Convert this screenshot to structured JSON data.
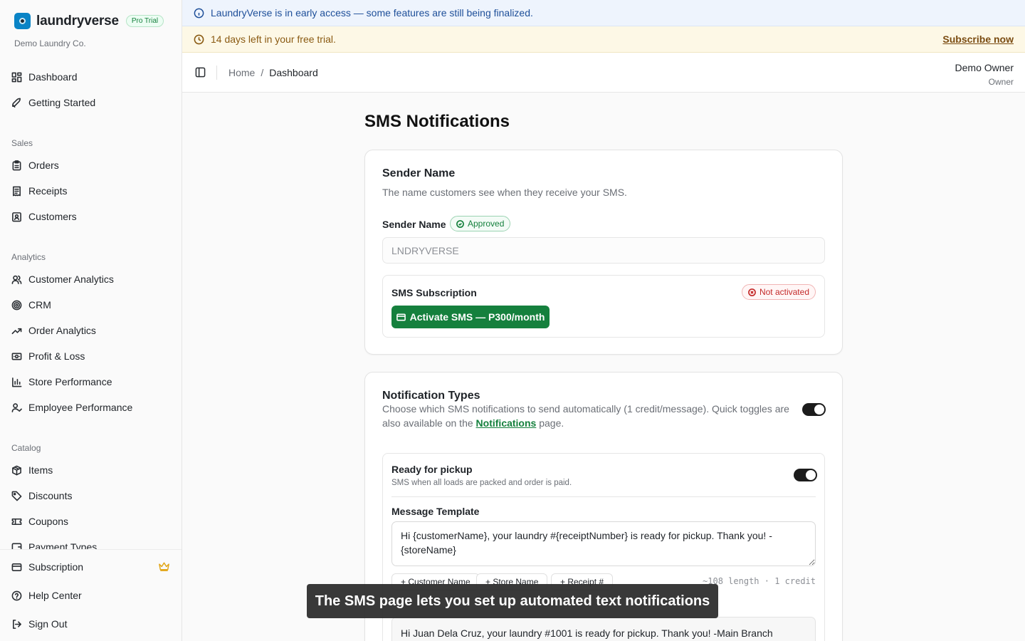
{
  "app": {
    "name": "laundryverse",
    "badge": "Pro Trial",
    "company": "Demo Laundry Co."
  },
  "sidebar": {
    "top_items": [
      {
        "label": "Dashboard",
        "icon": "grid-icon"
      },
      {
        "label": "Getting Started",
        "icon": "rocket-icon"
      }
    ],
    "sections": [
      {
        "title": "Sales",
        "items": [
          {
            "label": "Orders",
            "icon": "clipboard-icon"
          },
          {
            "label": "Receipts",
            "icon": "receipt-icon"
          },
          {
            "label": "Customers",
            "icon": "contact-icon"
          }
        ]
      },
      {
        "title": "Analytics",
        "items": [
          {
            "label": "Customer Analytics",
            "icon": "users-icon"
          },
          {
            "label": "CRM",
            "icon": "target-icon"
          },
          {
            "label": "Order Analytics",
            "icon": "trend-icon"
          },
          {
            "label": "Profit & Loss",
            "icon": "banknote-icon"
          },
          {
            "label": "Store Performance",
            "icon": "bar-chart-icon"
          },
          {
            "label": "Employee Performance",
            "icon": "user-check-icon"
          }
        ]
      },
      {
        "title": "Catalog",
        "items": [
          {
            "label": "Items",
            "icon": "package-icon"
          },
          {
            "label": "Discounts",
            "icon": "tag-icon"
          },
          {
            "label": "Coupons",
            "icon": "ticket-icon"
          },
          {
            "label": "Payment Types",
            "icon": "wallet-icon"
          }
        ]
      }
    ],
    "bottom_items": [
      {
        "label": "Subscription",
        "icon": "credit-card-icon"
      },
      {
        "label": "Help Center",
        "icon": "help-icon"
      },
      {
        "label": "Sign Out",
        "icon": "logout-icon"
      }
    ]
  },
  "banners": {
    "info": "LaundryVerse is in early access — some features are still being finalized.",
    "trial": "14 days left in your free trial.",
    "subscribe": "Subscribe now"
  },
  "header": {
    "breadcrumb": [
      "Home",
      "/",
      "Dashboard"
    ],
    "user_name": "Demo Owner",
    "user_role": "Owner"
  },
  "page": {
    "title": "SMS Notifications"
  },
  "sender_card": {
    "title": "Sender Name",
    "description": "The name customers see when they receive your SMS.",
    "field_label": "Sender Name",
    "status": "Approved",
    "value": "LNDRYVERSE",
    "subscription": {
      "title": "SMS Subscription",
      "status": "Not activated",
      "button": "Activate SMS — P300/month"
    }
  },
  "notification_card": {
    "title": "Notification Types",
    "description_prefix": "Choose which SMS notifications to send automatically (1 credit/message). Quick toggles are also available on the ",
    "description_link": "Notifications",
    "description_suffix": " page.",
    "master_toggle_on": true,
    "items": [
      {
        "title": "Ready for pickup",
        "description": "SMS when all loads are packed and order is paid.",
        "enabled": true,
        "template_label": "Message Template",
        "template": "Hi {customerName}, your laundry #{receiptNumber} is ready for pickup. Thank you! -{storeName}",
        "chips": [
          "+ Customer Name",
          "+ Store Name",
          "+ Receipt #"
        ],
        "counter": "~108 length · 1 credit",
        "preview": "Hi Juan Dela Cruz, your laundry #1001 is ready for pickup. Thank you! -Main Branch"
      }
    ]
  },
  "caption": "The SMS page lets you set up automated text notifications",
  "colors": {
    "accent": "#15803d",
    "info": "#1e4f99",
    "trial": "#8a5a12",
    "danger": "#c42b2b"
  }
}
